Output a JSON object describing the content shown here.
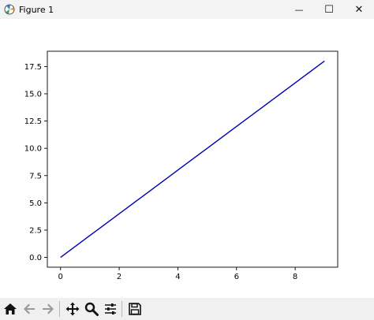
{
  "window": {
    "title": "Figure 1",
    "controls": {
      "minimize": "—",
      "maximize": "☐",
      "close": "✕"
    }
  },
  "toolbar": {
    "items": [
      {
        "name": "home-icon"
      },
      {
        "name": "back-icon"
      },
      {
        "name": "forward-icon"
      },
      {
        "name": "pan-icon"
      },
      {
        "name": "zoom-icon"
      },
      {
        "name": "configure-subplots-icon"
      },
      {
        "name": "save-icon"
      }
    ]
  },
  "colors": {
    "line": "#0000b3",
    "titlebar": "#f3f3f3",
    "toolbar": "#f0f0f0"
  },
  "chart_data": {
    "type": "line",
    "title": "",
    "xlabel": "",
    "ylabel": "",
    "xlim": [
      -0.45,
      9.45
    ],
    "ylim": [
      -0.9,
      18.9
    ],
    "xticks": [
      0,
      2,
      4,
      6,
      8
    ],
    "xtick_labels": [
      "0",
      "2",
      "4",
      "6",
      "8"
    ],
    "yticks": [
      0,
      2.5,
      5,
      7.5,
      10,
      12.5,
      15,
      17.5
    ],
    "ytick_labels": [
      "0.0",
      "2.5",
      "5.0",
      "7.5",
      "10.0",
      "12.5",
      "15.0",
      "17.5"
    ],
    "grid": false,
    "series": [
      {
        "x": [
          0,
          1,
          2,
          3,
          4,
          5,
          6,
          7,
          8,
          9
        ],
        "y": [
          0,
          2,
          4,
          6,
          8,
          10,
          12,
          14,
          16,
          18
        ]
      }
    ]
  }
}
